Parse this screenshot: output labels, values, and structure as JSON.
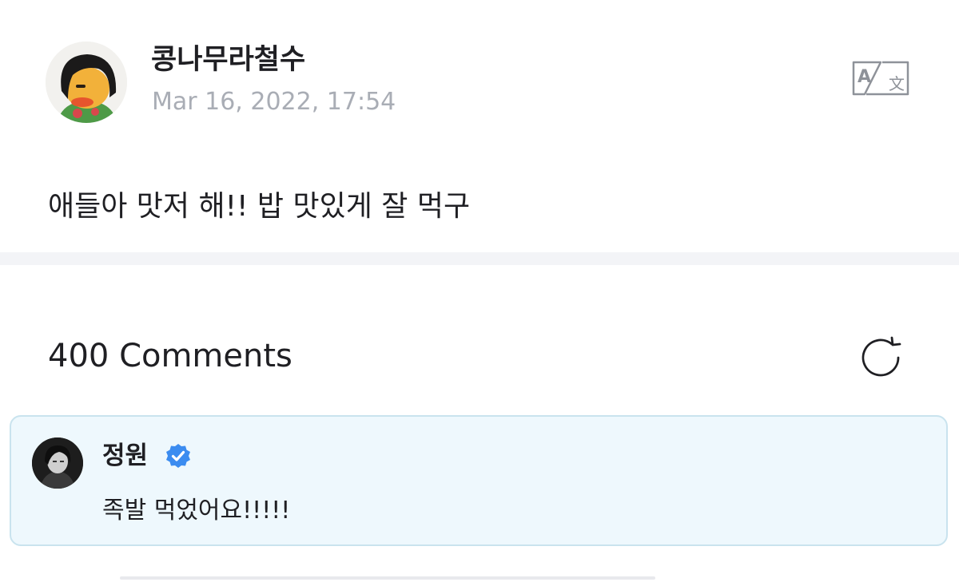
{
  "post": {
    "author": "콩나무라철수",
    "date": "Mar 16, 2022, 17:54",
    "body": "애들아 맛저 해!! 밥 맛있게 잘 먹구",
    "translate_icon": "translate-icon"
  },
  "comments": {
    "count_label": "400 Comments",
    "refresh_icon": "refresh-icon",
    "highlighted": {
      "author": "정원",
      "verified_icon": "verified-badge-icon",
      "text": "족발 먹었어요!!!!!"
    }
  },
  "colors": {
    "text_primary": "#1f1f23",
    "text_secondary": "#a9adb5",
    "card_background": "#eef8fd",
    "card_border": "#c9e3ee",
    "verified_blue": "#3b8cf0",
    "divider": "#f3f4f7"
  }
}
